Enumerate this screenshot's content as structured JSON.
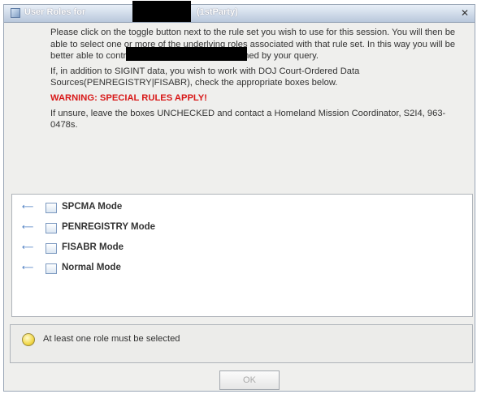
{
  "window": {
    "title": "User Roles for",
    "title_suffix": "(1stParty)",
    "close_glyph": "✕",
    "icon": "window-app-icon"
  },
  "instructions": {
    "line1": "Please click on the toggle button next to the rule set you wish to use for this                     session.  You will then be able to select one or more of the underlying roles associated with that rule set.  In this way you will be better able to control which databases are searched by your query.",
    "line2": "If, in addition to SIGINT data, you wish to work with DOJ Court-Ordered Data Sources(PENREGISTRY|FISABR), check the appropriate boxes below.",
    "warning": "WARNING: SPECIAL RULES APPLY!",
    "line3": "If unsure, leave the boxes UNCHECKED and contact a Homeland Mission Coordinator, S2I4, 963-0478s."
  },
  "modes": [
    {
      "label": "SPCMA Mode",
      "checked": false,
      "icon": "expand-arrow-icon"
    },
    {
      "label": "PENREGISTRY Mode",
      "checked": false,
      "icon": "expand-arrow-icon"
    },
    {
      "label": "FISABR Mode",
      "checked": false,
      "icon": "expand-arrow-icon"
    },
    {
      "label": "Normal Mode",
      "checked": false,
      "icon": "expand-arrow-icon"
    }
  ],
  "status": {
    "icon": "lightbulb-icon",
    "message": "At least one role must be selected"
  },
  "footer": {
    "ok_label": "OK",
    "ok_enabled": false
  },
  "colors": {
    "warning": "#d81818",
    "arrow": "#4a7cc2",
    "disabled_text": "#a9a9a9"
  }
}
